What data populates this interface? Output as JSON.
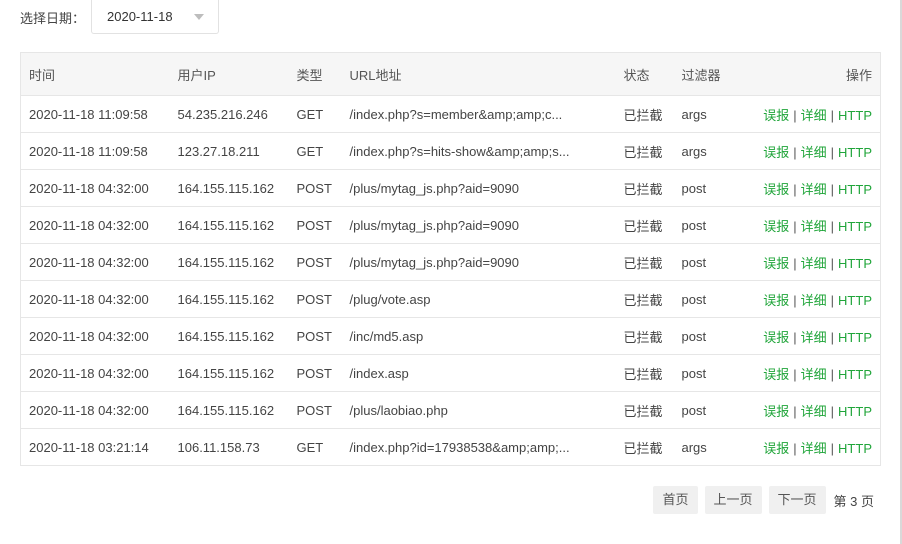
{
  "filter": {
    "label": "选择日期：",
    "selected_date": "2020-11-18"
  },
  "table": {
    "headers": {
      "time": "时间",
      "ip": "用户IP",
      "type": "类型",
      "url": "URL地址",
      "status": "状态",
      "filter": "过滤器",
      "actions": "操作"
    },
    "rows": [
      {
        "time": "2020-11-18 11:09:58",
        "ip": "54.235.216.246",
        "type": "GET",
        "url": "/index.php?s=member&amp;amp;c...",
        "status": "已拦截",
        "filter": "args"
      },
      {
        "time": "2020-11-18 11:09:58",
        "ip": "123.27.18.211",
        "type": "GET",
        "url": "/index.php?s=hits-show&amp;amp;s...",
        "status": "已拦截",
        "filter": "args"
      },
      {
        "time": "2020-11-18 04:32:00",
        "ip": "164.155.115.162",
        "type": "POST",
        "url": "/plus/mytag_js.php?aid=9090",
        "status": "已拦截",
        "filter": "post"
      },
      {
        "time": "2020-11-18 04:32:00",
        "ip": "164.155.115.162",
        "type": "POST",
        "url": "/plus/mytag_js.php?aid=9090",
        "status": "已拦截",
        "filter": "post"
      },
      {
        "time": "2020-11-18 04:32:00",
        "ip": "164.155.115.162",
        "type": "POST",
        "url": "/plus/mytag_js.php?aid=9090",
        "status": "已拦截",
        "filter": "post"
      },
      {
        "time": "2020-11-18 04:32:00",
        "ip": "164.155.115.162",
        "type": "POST",
        "url": "/plug/vote.asp",
        "status": "已拦截",
        "filter": "post"
      },
      {
        "time": "2020-11-18 04:32:00",
        "ip": "164.155.115.162",
        "type": "POST",
        "url": "/inc/md5.asp",
        "status": "已拦截",
        "filter": "post"
      },
      {
        "time": "2020-11-18 04:32:00",
        "ip": "164.155.115.162",
        "type": "POST",
        "url": "/index.asp",
        "status": "已拦截",
        "filter": "post"
      },
      {
        "time": "2020-11-18 04:32:00",
        "ip": "164.155.115.162",
        "type": "POST",
        "url": "/plus/laobiao.php",
        "status": "已拦截",
        "filter": "post"
      },
      {
        "time": "2020-11-18 03:21:14",
        "ip": "106.11.158.73",
        "type": "GET",
        "url": "/index.php?id=17938538&amp;amp;...",
        "status": "已拦截",
        "filter": "args"
      }
    ],
    "actions": {
      "report": "误报",
      "detail": "详细",
      "http": "HTTP",
      "separator": "|"
    }
  },
  "pagination": {
    "first": "首页",
    "prev": "上一页",
    "next": "下一页",
    "info": "第 3 页"
  },
  "colors": {
    "accent": "#20a53a",
    "header_bg": "#f6f6f6",
    "border": "#e6e6e6",
    "pager_bg": "#f0f0f0"
  }
}
